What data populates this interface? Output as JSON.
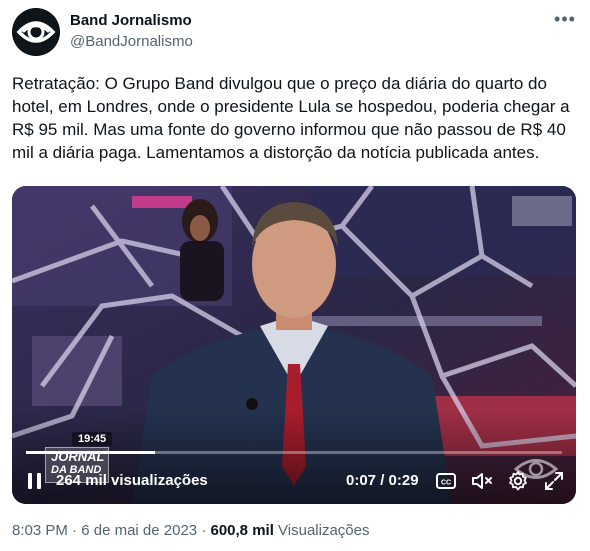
{
  "author": {
    "name": "Band Jornalismo",
    "handle": "@BandJornalismo",
    "avatar_icon": "band-eye-logo-icon"
  },
  "more_icon": "more-horizontal-icon",
  "tweet": {
    "text": "Retratação: O Grupo Band divulgou que o preço da diária do quarto do hotel, em Londres, onde o presidente Lula se hospedou, poderia chegar a R$ 95 mil. Mas uma fonte do governo informou que não passou de R$ 40 mil a diária paga. Lamentamos a distorção da notícia publicada antes."
  },
  "video": {
    "clock": "19:45",
    "show_logo_line1": "JORNAL",
    "show_logo_line2": "DA BAND",
    "views_label": "264 mil visualizações",
    "time_display": "0:07 / 0:29",
    "progress_fraction": 0.24,
    "icons": [
      "pause-icon",
      "closed-captions-icon",
      "volume-muted-icon",
      "settings-gear-icon",
      "fullscreen-icon"
    ]
  },
  "meta": {
    "time": "8:03 PM",
    "date": "6 de mai de 2023",
    "separator": "·",
    "views_count": "600,8 mil",
    "views_word": "Visualizações"
  },
  "colors": {
    "text": "#0f1419",
    "secondary": "#536471"
  }
}
